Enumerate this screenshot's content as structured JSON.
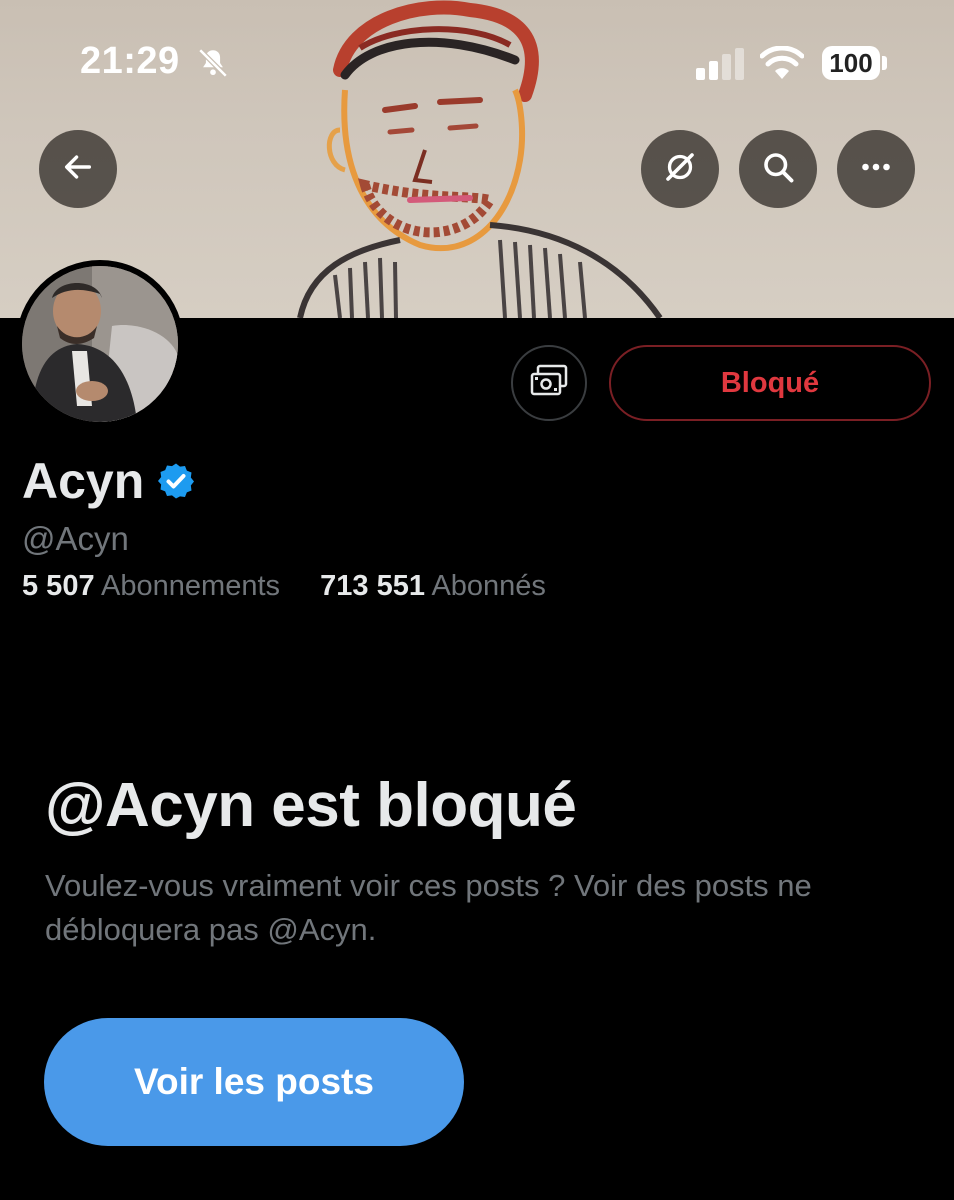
{
  "status_bar": {
    "time": "21:29",
    "battery": "100",
    "icons": [
      "bell-slash-icon",
      "signal-icon",
      "wifi-icon",
      "battery-icon"
    ]
  },
  "header": {
    "back_icon": "arrow-left-icon",
    "actions": [
      "grok-icon",
      "search-icon",
      "more-icon"
    ]
  },
  "profile": {
    "display_name": "Acyn",
    "handle": "@Acyn",
    "verified": true,
    "following_count": "5 507",
    "following_label": "Abonnements",
    "followers_count": "713 551",
    "followers_label": "Abonnés",
    "blocked_button_label": "Bloqué",
    "subscribe_icon": "money-icon"
  },
  "blocked_notice": {
    "title": "@Acyn est bloqué",
    "description": "Voulez-vous vraiment voir ces posts ? Voir des posts ne débloquera pas @Acyn.",
    "view_posts_label": "Voir les posts"
  },
  "colors": {
    "background": "#000000",
    "accent_blue": "#4a99e9",
    "blocked_red": "#e0383f",
    "muted_text": "#71767b",
    "primary_text": "#e7e9ea"
  }
}
